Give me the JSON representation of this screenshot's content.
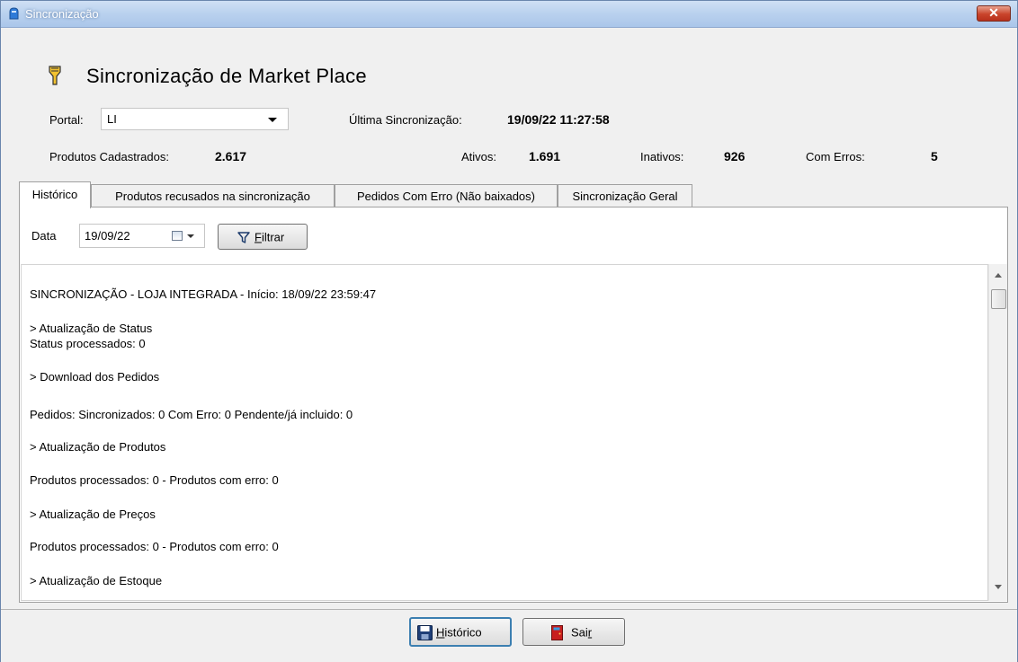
{
  "window": {
    "title": "Sincronização",
    "close": "✕"
  },
  "header": {
    "title": "Sincronização de Market Place"
  },
  "portal": {
    "label": "Portal:",
    "value": "LI"
  },
  "last_sync": {
    "label": "Última Sincronização:",
    "value": "19/09/22 11:27:58"
  },
  "stats": {
    "cadastrados_label": "Produtos Cadastrados:",
    "cadastrados_value": "2.617",
    "ativos_label": "Ativos:",
    "ativos_value": "1.691",
    "inativos_label": "Inativos:",
    "inativos_value": "926",
    "erros_label": "Com Erros:",
    "erros_value": "5"
  },
  "tabs": [
    {
      "label": "Histórico"
    },
    {
      "label": "Produtos recusados na sincronização"
    },
    {
      "label": "Pedidos Com Erro (Não baixados)"
    },
    {
      "label": "Sincronização Geral"
    }
  ],
  "filter": {
    "date_label": "Data",
    "date_value": "19/09/22",
    "filter_button_first": "F",
    "filter_button_rest": "iltrar"
  },
  "log": [
    "SINCRONIZAÇÃO - LOJA INTEGRADA - Início: 18/09/22 23:59:47",
    "> Atualização de Status",
    "Status processados: 0",
    "> Download dos Pedidos",
    "Pedidos: Sincronizados: 0  Com Erro: 0  Pendente/já incluido: 0",
    "> Atualização de Produtos",
    "Produtos processados: 0 - Produtos com erro: 0",
    "> Atualização de Preços",
    "Produtos processados: 0 - Produtos com erro: 0",
    "> Atualização de Estoque"
  ],
  "buttons": {
    "historico_first": "H",
    "historico_rest": "istórico",
    "sair_first": "Sai",
    "sair_rest": "r"
  },
  "colors": {
    "title_bar": "#b9d1ee",
    "close_button": "#c9442b",
    "window_bg": "#f0f0f0"
  }
}
